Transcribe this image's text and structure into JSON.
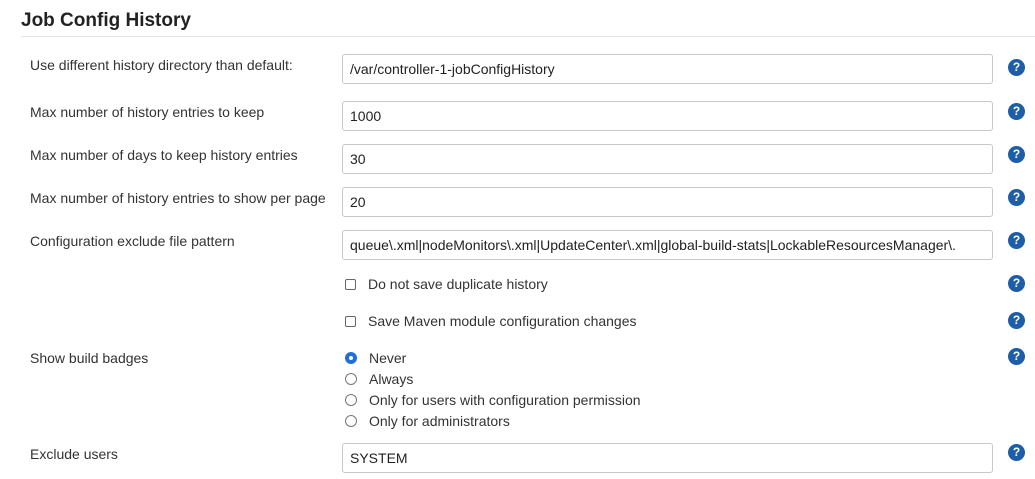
{
  "section": {
    "title": "Job Config History"
  },
  "fields": {
    "history_dir": {
      "label": "Use different history directory than default:",
      "value": "/var/controller-1-jobConfigHistory"
    },
    "max_entries": {
      "label": "Max number of history entries to keep",
      "value": "1000"
    },
    "max_days": {
      "label": "Max number of days to keep history entries",
      "value": "30"
    },
    "max_per_page": {
      "label": "Max number of history entries to show per page",
      "value": "20"
    },
    "exclude_pattern": {
      "label": "Configuration exclude file pattern",
      "value": "queue\\.xml|nodeMonitors\\.xml|UpdateCenter\\.xml|global-build-stats|LockableResourcesManager\\."
    },
    "exclude_users": {
      "label": "Exclude users",
      "value": "SYSTEM"
    }
  },
  "checkboxes": {
    "no_duplicates": {
      "label": "Do not save duplicate history",
      "checked": false
    },
    "maven_changes": {
      "label": "Save Maven module configuration changes",
      "checked": false
    }
  },
  "build_badges": {
    "label": "Show build badges",
    "options": [
      {
        "label": "Never",
        "selected": true
      },
      {
        "label": "Always",
        "selected": false
      },
      {
        "label": "Only for users with configuration permission",
        "selected": false
      },
      {
        "label": "Only for administrators",
        "selected": false
      }
    ]
  },
  "help_icon": {
    "glyph": "?",
    "color": "#1e5ea8"
  }
}
